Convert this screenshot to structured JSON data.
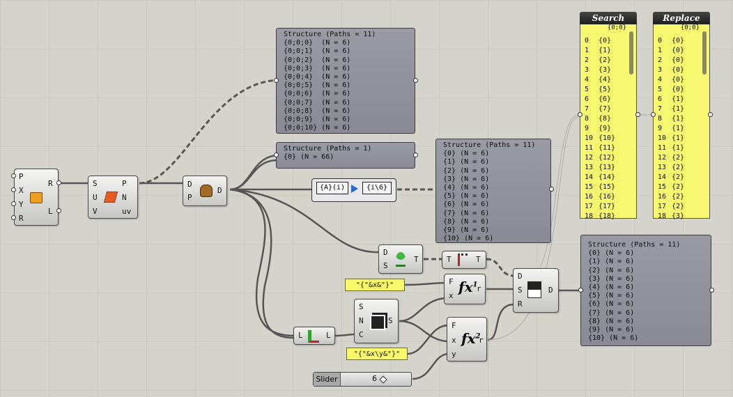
{
  "colors": {
    "canvas": "#d5d4cc",
    "panel_gray": "#9a9aa4",
    "panel_yellow": "#f8f86a",
    "wire": "#555555"
  },
  "components": {
    "plane": {
      "inputs": [
        "P",
        "X",
        "Y",
        "R"
      ],
      "outputs": [
        "R",
        "L"
      ],
      "icon": "rectangle-icon"
    },
    "surface": {
      "inputs": [
        "S",
        "U",
        "V"
      ],
      "outputs": [
        "P",
        "N",
        "uv"
      ],
      "icon": "surface-divide-icon"
    },
    "stump": {
      "inputs": [
        "D",
        "P"
      ],
      "outputs": [
        "D"
      ],
      "icon": "tree-stump-icon"
    },
    "sprout": {
      "inputs": [
        "D",
        "S"
      ],
      "outputs": [
        "T"
      ],
      "icon": "sprout-icon"
    },
    "branch": {
      "inputs": [
        "T"
      ],
      "outputs": [
        "T"
      ],
      "icon": "tree-branch-icon"
    },
    "replace": {
      "inputs": [
        "D",
        "S",
        "R"
      ],
      "outputs": [
        "D"
      ],
      "icon": "replace-paths-icon"
    },
    "fx1": {
      "inputs": [
        "F",
        "x"
      ],
      "outputs": [
        "r"
      ],
      "label": "fx",
      "sup": "1"
    },
    "fx2": {
      "inputs": [
        "F",
        "x",
        "y"
      ],
      "outputs": [
        "r"
      ],
      "label": "fx",
      "sup": "2"
    },
    "series": {
      "inputs": [
        "S",
        "N",
        "C"
      ],
      "outputs": [
        "S"
      ],
      "icon": "series-icon"
    },
    "listlen": {
      "inputs": [
        "L"
      ],
      "outputs": [
        "L"
      ],
      "icon": "list-length-icon"
    }
  },
  "panels": {
    "p1": {
      "title": "Structure (Paths = 11)",
      "rows": [
        "{0;0;0}  (N = 6)",
        "{0;0;1}  (N = 6)",
        "{0;0;2}  (N = 6)",
        "{0;0;3}  (N = 6)",
        "{0;0;4}  (N = 6)",
        "{0;0;5}  (N = 6)",
        "{0;0;6}  (N = 6)",
        "{0;0;7}  (N = 6)",
        "{0;0;8}  (N = 6)",
        "{0;0;9}  (N = 6)",
        "{0;0;10} (N = 6)"
      ]
    },
    "p2": {
      "title": "Structure (Paths = 1)",
      "rows": [
        "{0} (N = 66)"
      ]
    },
    "p3": {
      "title": "Structure (Paths = 11)",
      "rows": [
        "{0} (N = 6)",
        "{1} (N = 6)",
        "{2} (N = 6)",
        "{3} (N = 6)",
        "{4} (N = 6)",
        "{5} (N = 6)",
        "{6} (N = 6)",
        "{7} (N = 6)",
        "{8} (N = 6)",
        "{9} (N = 6)",
        "{10} (N = 6)"
      ]
    },
    "p4": {
      "title": "Structure (Paths = 11)",
      "rows": [
        "{0} (N = 6)",
        "{1} (N = 6)",
        "{2} (N = 6)",
        "{3} (N = 6)",
        "{4} (N = 6)",
        "{5} (N = 6)",
        "{6} (N = 6)",
        "{7} (N = 6)",
        "{8} (N = 6)",
        "{9} (N = 6)",
        "{10} (N = 6)"
      ]
    }
  },
  "search": {
    "header": "Search",
    "path": "{0;0}",
    "indices": [
      "0",
      "1",
      "2",
      "3",
      "4",
      "5",
      "6",
      "7",
      "8",
      "9",
      "10",
      "11",
      "12",
      "13",
      "14",
      "15",
      "16",
      "17",
      "18"
    ],
    "values": [
      "{0}",
      "{1}",
      "{2}",
      "{3}",
      "{4}",
      "{5}",
      "{6}",
      "{7}",
      "{8}",
      "{9}",
      "{10}",
      "{11}",
      "{12}",
      "{13}",
      "{14}",
      "{15}",
      "{16}",
      "{17}",
      "{18}"
    ]
  },
  "replace": {
    "header": "Replace",
    "path": "{0;0}",
    "indices": [
      "0",
      "1",
      "2",
      "3",
      "4",
      "5",
      "6",
      "7",
      "8",
      "9",
      "10",
      "11",
      "12",
      "13",
      "14",
      "15",
      "16",
      "17",
      "18"
    ],
    "values": [
      "{0}",
      "{0}",
      "{0}",
      "{0}",
      "{0}",
      "{0}",
      "{1}",
      "{1}",
      "{1}",
      "{1}",
      "{1}",
      "{1}",
      "{2}",
      "{2}",
      "{2}",
      "{2}",
      "{2}",
      "{2}",
      "{3}"
    ]
  },
  "expression": {
    "from": "{A}(i)",
    "to": "{i\\6}"
  },
  "strings": {
    "s1": "\"{\"&x&\"}\"",
    "s2": "\"{\"&x\\y&\"}\""
  },
  "slider": {
    "label": "Slider",
    "value": "6"
  }
}
